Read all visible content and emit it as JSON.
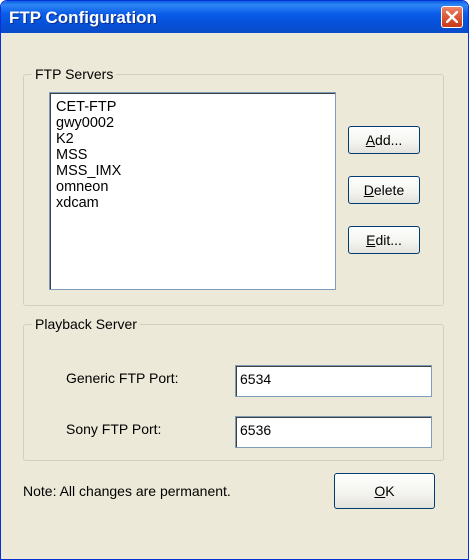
{
  "window": {
    "title": "FTP Configuration"
  },
  "ftp_servers": {
    "group_label": "FTP Servers",
    "items": [
      "CET-FTP",
      "gwy0002",
      "K2",
      "MSS",
      "MSS_IMX",
      "omneon",
      "xdcam"
    ],
    "buttons": {
      "add": {
        "mnemonic": "A",
        "rest": "dd..."
      },
      "delete": {
        "mnemonic": "D",
        "rest": "elete"
      },
      "edit": {
        "mnemonic": "E",
        "rest": "dit..."
      }
    }
  },
  "playback_server": {
    "group_label": "Playback Server",
    "generic_label": "Generic FTP Port:",
    "generic_value": "6534",
    "sony_label": "Sony FTP Port:",
    "sony_value": "6536"
  },
  "footer": {
    "note": "Note: All changes are permanent.",
    "ok": {
      "mnemonic": "O",
      "rest": "K"
    }
  }
}
